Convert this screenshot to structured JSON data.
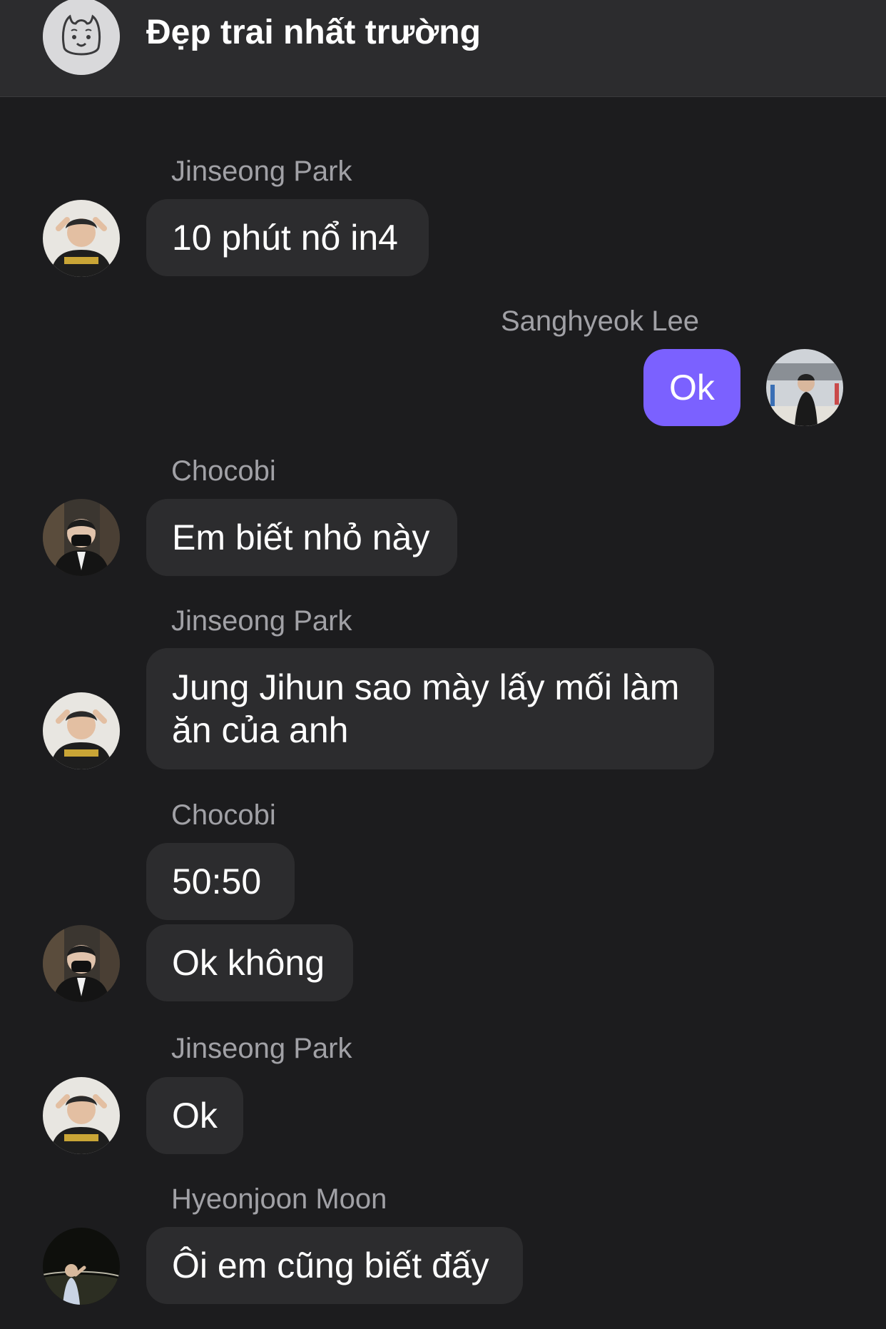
{
  "header": {
    "title": "Đẹp trai nhất trường",
    "avatar_icon": "alpaca-icon"
  },
  "messages": [
    {
      "sender": "Jinseong Park",
      "text": "10 phút nổ in4",
      "mine": false
    },
    {
      "sender": "Sanghyeok Lee",
      "text": "Ok",
      "mine": true
    },
    {
      "sender": "Chocobi",
      "text": "Em biết nhỏ này",
      "mine": false
    },
    {
      "sender": "Jinseong Park",
      "text": "Jung Jihun sao mày lấy mối làm ăn của anh",
      "mine": false
    },
    {
      "sender": "Chocobi",
      "text": "50:50",
      "mine": false
    },
    {
      "sender": "Chocobi",
      "text": "Ok không",
      "mine": false
    },
    {
      "sender": "Jinseong Park",
      "text": "Ok",
      "mine": false
    },
    {
      "sender": "Hyeonjoon Moon",
      "text": "Ôi em cũng biết đấy",
      "mine": false
    }
  ],
  "colors": {
    "background": "#1c1c1e",
    "header": "#2c2c2e",
    "bubble_other": "#2c2c2e",
    "bubble_mine": "#7b61ff",
    "sender_name": "#a1a1a6"
  }
}
